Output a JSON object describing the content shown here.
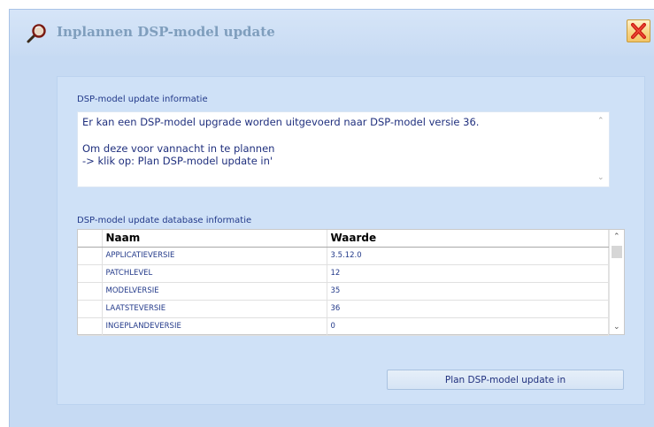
{
  "window": {
    "title": "Inplannen DSP-model update",
    "title_icon": "magnifier-wrench-icon",
    "close_icon": "close-x-icon"
  },
  "info_section": {
    "label": "DSP-model update informatie",
    "lines": [
      "Er kan een DSP-model upgrade worden uitgevoerd naar DSP-model versie 36.",
      "",
      "Om deze voor vannacht in te plannen",
      "-> klik op: Plan DSP-model update in'"
    ]
  },
  "db_section": {
    "label": "DSP-model update database informatie",
    "columns": [
      "Naam",
      "Waarde"
    ],
    "rows": [
      [
        "APPLICATIEVERSIE",
        "3.5.12.0"
      ],
      [
        "PATCHLEVEL",
        "12"
      ],
      [
        "MODELVERSIE",
        "35"
      ],
      [
        "LAATSTEVERSIE",
        "36"
      ],
      [
        "INGEPLANDEVERSIE",
        "0"
      ]
    ]
  },
  "actions": {
    "plan_button": "Plan DSP-model update in"
  },
  "colors": {
    "background": "#c6daf3",
    "panel": "#cfe1f7",
    "text_blue": "#233a8a",
    "title_text": "#7f9ebd",
    "close_red": "#cc1b12"
  }
}
